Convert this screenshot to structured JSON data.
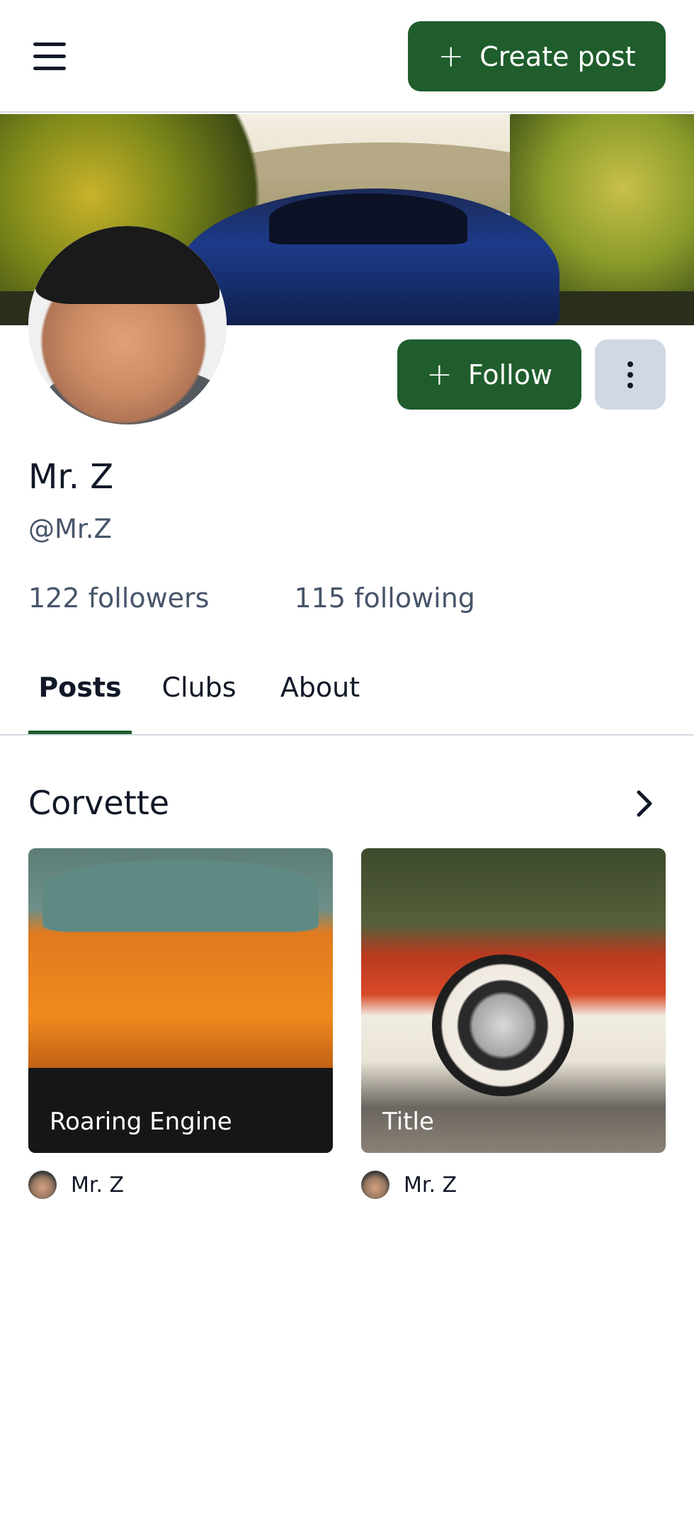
{
  "header": {
    "create_post_label": "Create post"
  },
  "profile": {
    "name": "Mr. Z",
    "handle": "@Mr.Z",
    "followers": "122 followers",
    "following": "115 following",
    "follow_label": "Follow"
  },
  "tabs": [
    {
      "label": "Posts",
      "active": true
    },
    {
      "label": "Clubs",
      "active": false
    },
    {
      "label": "About",
      "active": false
    }
  ],
  "section": {
    "title": "Corvette"
  },
  "posts": [
    {
      "title": "Roaring Engine",
      "author": "Mr. Z"
    },
    {
      "title": "Title",
      "author": "Mr. Z"
    }
  ],
  "colors": {
    "primary": "#1f5d2c",
    "secondary_button": "#cfd8e3",
    "muted_text": "#475569",
    "divider": "#d3dae3"
  }
}
